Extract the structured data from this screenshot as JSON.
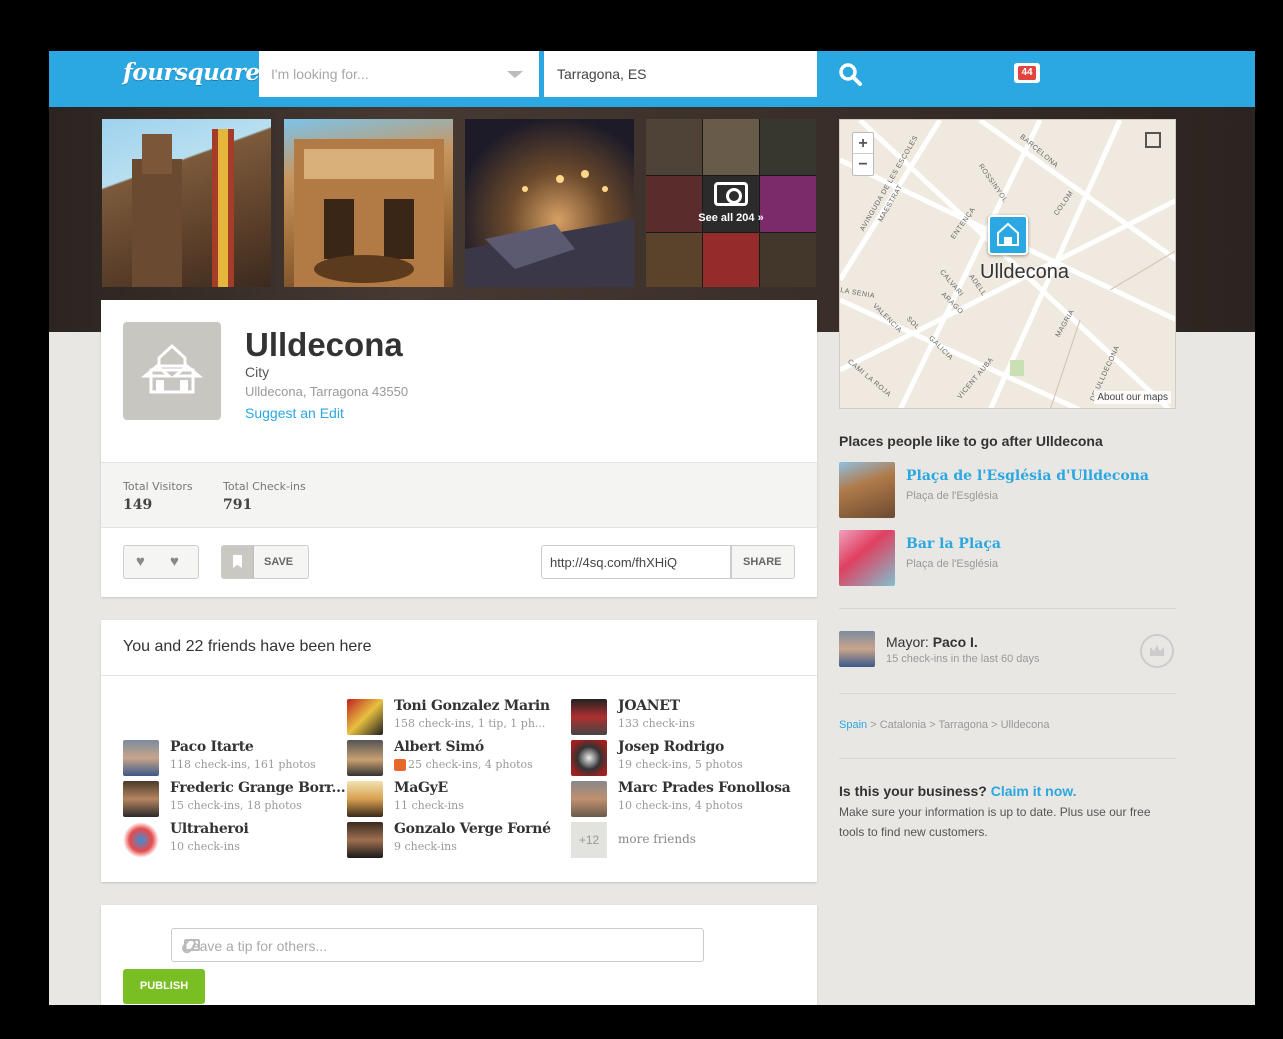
{
  "header": {
    "logo": "foursquare",
    "search_placeholder": "I'm looking for...",
    "location_value": "Tarragona, ES",
    "notification_count": "44"
  },
  "photos": {
    "see_all": "See all 204 »"
  },
  "map": {
    "zoom_in": "+",
    "zoom_out": "−",
    "pin_label": "Ulldecona",
    "about": "About our maps",
    "streets": [
      "BARCELONA",
      "ROSSINYOL",
      "COLOM",
      "ENTENÇA",
      "AVINGUDA DE LES ESCOLES",
      "MAESTRAT",
      "CALVARI",
      "ADELL",
      "ARAGO",
      "SOL",
      "GALICIA",
      "VALENCIA",
      "VICENT AUBA",
      "MAGRIA",
      "CAMI LA ROJA",
      "LA SENIA",
      "DE ULLDECONA"
    ]
  },
  "venue": {
    "name": "Ulldecona",
    "category": "City",
    "address": "Ulldecona, Tarragona 43550",
    "suggest_edit": "Suggest an Edit",
    "stats": [
      {
        "label": "Total Visitors",
        "value": "149"
      },
      {
        "label": "Total Check-ins",
        "value": "791"
      }
    ],
    "save_label": "SAVE",
    "short_url": "http://4sq.com/fhXHiQ",
    "share_label": "SHARE"
  },
  "friends": {
    "title": "You and 22 friends have been here",
    "list": [
      {
        "name": "Paco Itarte",
        "stats": "118 check-ins, 161 photos"
      },
      {
        "name": "Frederic Grange Borr...",
        "stats": "15 check-ins, 18 photos"
      },
      {
        "name": "Ultraheroi",
        "stats": "10 check-ins"
      },
      {
        "name": "Toni Gonzalez Marin",
        "stats": "158 check-ins, 1 tip, 1 ph..."
      },
      {
        "name": "Albert Simó",
        "stats": "25 check-ins, 4 photos"
      },
      {
        "name": "MaGyE",
        "stats": "11 check-ins"
      },
      {
        "name": "Gonzalo Verge Forné",
        "stats": "9 check-ins"
      },
      {
        "name": "JOANET",
        "stats": "133 check-ins"
      },
      {
        "name": "Josep Rodrigo",
        "stats": "19 check-ins, 5 photos"
      },
      {
        "name": "Marc Prades Fonollosa",
        "stats": "10 check-ins, 4 photos"
      }
    ],
    "more_count": "+12",
    "more_label": "more friends"
  },
  "tip": {
    "placeholder": "Leave a tip for others...",
    "publish": "PUBLISH"
  },
  "sidebar": {
    "places_title": "Places people like to go after Ulldecona",
    "places": [
      {
        "name": "Plaça de l'Església d'Ulldecona",
        "address": "Plaça de l'Església"
      },
      {
        "name": "Bar la Plaça",
        "address": "Plaça de l'Església"
      }
    ],
    "mayor_prefix": "Mayor:",
    "mayor_name": "Paco I.",
    "mayor_stats": "15 check-ins in the last 60 days",
    "breadcrumb": [
      "Spain",
      "Catalonia",
      "Tarragona",
      "Ulldecona"
    ],
    "business_question": "Is this your business?",
    "claim_link": "Claim it now.",
    "business_desc": "Make sure your information is up to date. Plus use our free tools to find new customers."
  },
  "colors": {
    "brand_blue": "#2ba7e1",
    "publish_green": "#79bf23",
    "badge_red": "#e0443d"
  }
}
